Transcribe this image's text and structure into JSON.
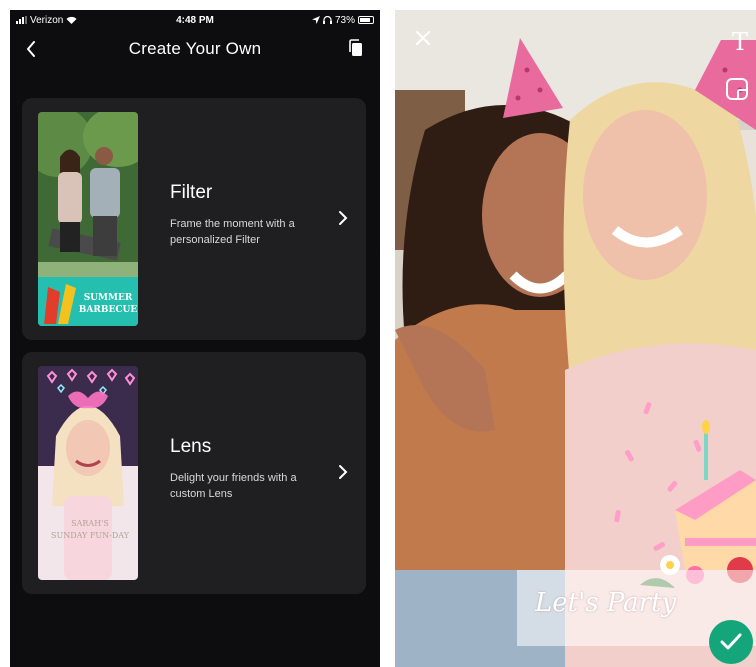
{
  "status_bar": {
    "carrier": "Verizon",
    "time": "4:48 PM",
    "battery": "73%"
  },
  "header": {
    "title": "Create Your Own",
    "back_icon": "chevron-left-icon",
    "copy_icon": "copy-icon"
  },
  "options": [
    {
      "title": "Filter",
      "description": "Frame the moment with a personalized Filter",
      "thumb_text": [
        "SUMMER",
        "BARBECUE"
      ]
    },
    {
      "title": "Lens",
      "description": "Delight your friends with a custom Lens",
      "thumb_text": [
        "SARAH'S",
        "SUNDAY FUN-DAY"
      ]
    }
  ],
  "preview": {
    "caption": "Let's Party",
    "close_icon": "close-icon",
    "text_tool_label": "T",
    "sticker_icon": "sticker-icon",
    "confirm_icon": "checkmark-icon"
  },
  "colors": {
    "app_bg": "#0d0d0f",
    "card_bg": "#1f1f22",
    "confirm": "#14a57a",
    "party_hat": "#e96a9c"
  }
}
